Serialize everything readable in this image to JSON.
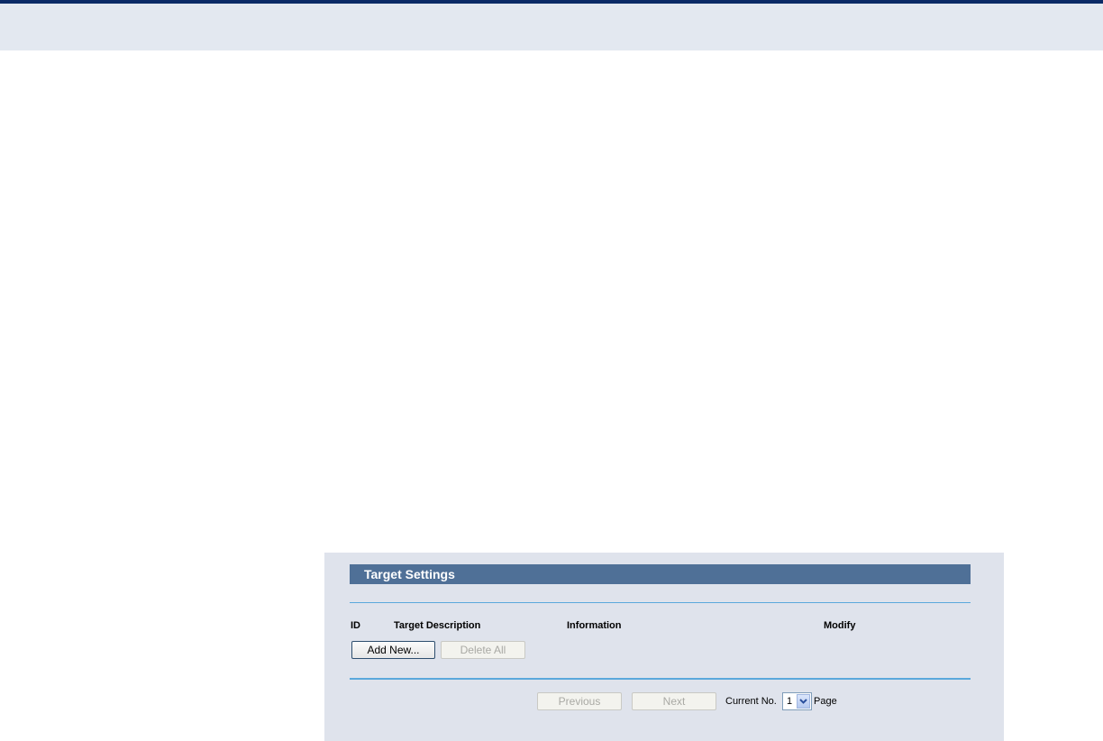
{
  "section": {
    "title": "Target Settings"
  },
  "table": {
    "columns": [
      "ID",
      "Target Description",
      "Information",
      "Modify"
    ]
  },
  "actions": {
    "add_new_label": "Add New...",
    "delete_all_label": "Delete All"
  },
  "pagination": {
    "previous_label": "Previous",
    "next_label": "Next",
    "current_no_label": "Current No.",
    "page_value": "1",
    "page_label": "Page"
  },
  "colors": {
    "header_bg": "#4f7097",
    "panel_bg": "#dfe3ec",
    "rule": "#5ba8dc",
    "top_stripe": "#0b2a66"
  },
  "icons": {
    "select_arrow": "chevron-down-icon"
  }
}
